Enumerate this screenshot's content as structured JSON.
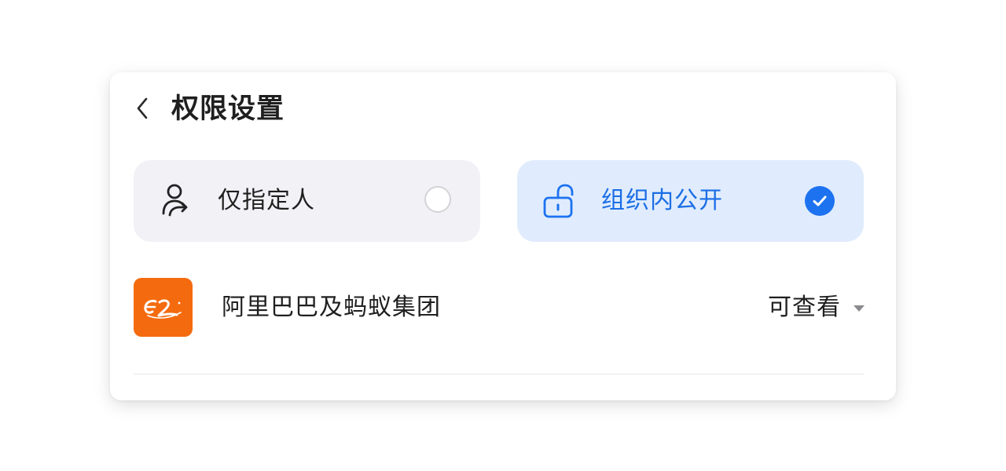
{
  "header": {
    "back_icon": "chevron-left-icon",
    "title": "权限设置"
  },
  "options": [
    {
      "id": "private",
      "label": "仅指定人",
      "icon": "person-share-icon",
      "selected": false
    },
    {
      "id": "public",
      "label": "组织内公开",
      "icon": "unlock-icon",
      "selected": true
    }
  ],
  "organization": {
    "logo": "alibaba-logo",
    "name": "阿里巴巴及蚂蚁集团",
    "permission": "可查看",
    "permission_icon": "caret-down-icon"
  },
  "colors": {
    "accent": "#1d72f0",
    "accent_text": "#1a6ee6",
    "selected_bg": "#e0ecfd",
    "unselected_bg": "#f1f1f6",
    "logo_bg": "#f46b0f"
  }
}
